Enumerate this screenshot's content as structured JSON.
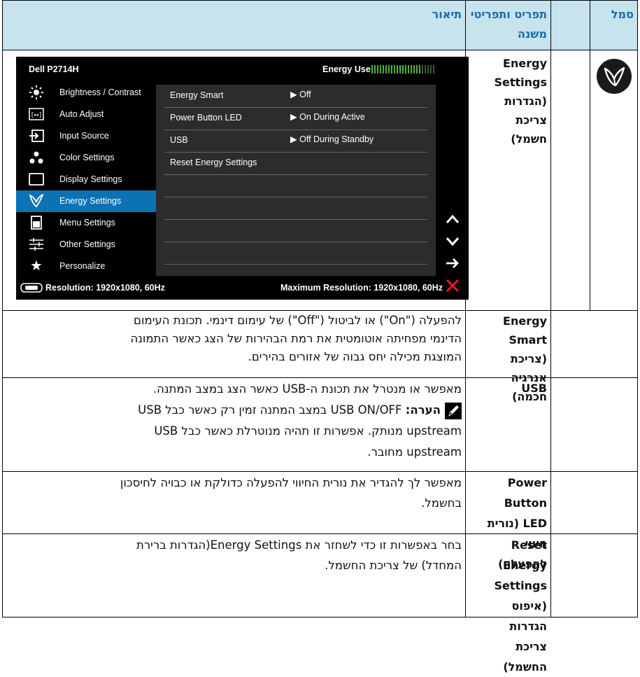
{
  "header": {
    "col_symbol": "סמל",
    "col_menu_line1": "תפריט ותפריטי",
    "col_menu_line2": "משנה",
    "col_desc": "תיאור"
  },
  "energy_row": {
    "title_line1": "Energy",
    "title_line2": "Settings",
    "title_line3": "(הגדרות צריכת",
    "title_line4": "חשמל)",
    "icon": "leaf-icon"
  },
  "osd": {
    "model": "Dell P2714H",
    "energy_use_label": "Energy Use",
    "menu": [
      {
        "label": "Brightness / Contrast",
        "icon": "sun-icon"
      },
      {
        "label": "Auto Adjust",
        "icon": "auto-adjust-icon"
      },
      {
        "label": "Input Source",
        "icon": "input-source-icon"
      },
      {
        "label": "Color Settings",
        "icon": "color-dots-icon"
      },
      {
        "label": "Display Settings",
        "icon": "display-icon"
      },
      {
        "label": "Energy Settings",
        "icon": "leaf-icon",
        "selected": true
      },
      {
        "label": "Menu Settings",
        "icon": "menu-icon"
      },
      {
        "label": "Other Settings",
        "icon": "sliders-icon"
      },
      {
        "label": "Personalize",
        "icon": "star-icon"
      }
    ],
    "options": [
      {
        "name": "Energy Smart",
        "value": "Off"
      },
      {
        "name": "Power Button LED",
        "value": "On During Active"
      },
      {
        "name": "USB",
        "value": "Off During Standby"
      },
      {
        "name": "Reset Energy Settings",
        "value": ""
      }
    ],
    "resolution": "Resolution: 1920x1080, 60Hz",
    "max_resolution": "Maximum Resolution: 1920x1080, 60Hz",
    "accent": "#0b72b5"
  },
  "rows": [
    {
      "name_lines": [
        "Energy Smart",
        "(צריכת אנרגיה",
        "חכמה)"
      ],
      "desc_lines": [
        "להפעלה (\"On\") או לביטול (\"Off\") של עימום דינמי. תכונת העימום",
        "הדינמי מפחיתה אוטומטית את רמת הבהירות של הצג כאשר התמונה",
        "המוצגת מכילה יחס גבוה של אזורים בהירים."
      ]
    },
    {
      "name_lines": [
        "USB"
      ],
      "desc_line1": "מאפשר או מנטרל את תכונת ה-USB כאשר הצג במצב המתנה.",
      "note_label": "הערה:",
      "note_text": " USB ON/OFF במצב המתנה זמין רק כאשר כבל USB",
      "desc_line3": "upstream מנותק. אפשרות זו תהיה מנוטרלת כאשר כבל USB",
      "desc_line4": "upstream מחובר."
    },
    {
      "name_lines": [
        "Power Button",
        "LED (נורית חיווי",
        "להפעלה)"
      ],
      "desc_lines": [
        "מאפשר לך להגדיר את נורית החיווי להפעלה כדולקת או כבויה לחיסכון",
        "בחשמל."
      ]
    },
    {
      "name_lines": [
        "Reset Energy",
        "Settings (איפוס",
        "הגדרות צריכת",
        "החשמל)"
      ],
      "desc_lines": [
        "בחר באפשרות זו כדי לשחזר את Energy Settings(הגדרות ברירת",
        "המחדל) של צריכת החשמל."
      ]
    }
  ]
}
